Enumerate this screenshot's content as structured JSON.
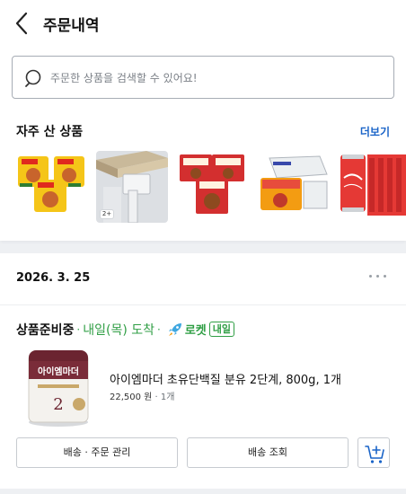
{
  "header": {
    "title": "주문내역",
    "back_icon": "chevron-left-icon"
  },
  "search": {
    "placeholder": "주문한 상품을 검색할 수 있어요!",
    "icon": "search-icon"
  },
  "frequent": {
    "title": "자주 산 상품",
    "more_label": "더보기",
    "items": [
      {
        "name": "ramen-bundle",
        "badge": ""
      },
      {
        "name": "shelf-bracket",
        "badge": "2+"
      },
      {
        "name": "nongshim-ramen",
        "badge": ""
      },
      {
        "name": "samyang-ramen",
        "badge": ""
      },
      {
        "name": "coca-cola-cans",
        "badge": ""
      }
    ]
  },
  "order": {
    "date": "2026. 3. 25",
    "menu_icon": "more-horizontal-icon",
    "status": "상품준비중",
    "separator": "·",
    "eta": "내일(목) 도착",
    "rocket_label": "로켓",
    "rocket_badge": "내일",
    "product": {
      "name": "아이엠마더 초유단백질 분유 2단계, 800g, 1개",
      "price": "22,500 원",
      "quantity": "1개",
      "can_brand": "아이엠마더",
      "can_stage": "2"
    },
    "buttons": {
      "manage": "배송 · 주문 관리",
      "track": "배송 조회",
      "cart_icon": "add-to-cart-icon"
    }
  },
  "colors": {
    "accent_blue": "#1a64c8",
    "rocket_green": "#2f9e44",
    "page_bg": "#eef0f3"
  }
}
